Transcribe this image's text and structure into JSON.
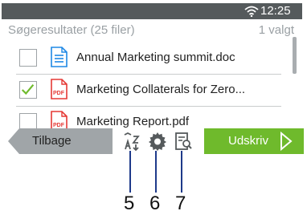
{
  "status": {
    "time": "12:25 PM"
  },
  "header": {
    "title": "Søgeresultater (25 filer)",
    "selected": "1 valgt"
  },
  "files": [
    {
      "name": "Annual Marketing summit.doc",
      "type": "doc",
      "checked": false
    },
    {
      "name": "Marketing Collaterals for Zero...",
      "type": "pdf",
      "checked": true
    },
    {
      "name": "Marketing Report.pdf",
      "type": "pdf",
      "checked": false
    }
  ],
  "file_icons": {
    "doc": "PDF",
    "pdf": "PDF"
  },
  "toolbar": {
    "back_label": "Tilbage",
    "print_label": "Udskriv",
    "icons": [
      "sort-icon",
      "settings-gear-icon",
      "preview-icon"
    ]
  },
  "callouts": [
    "5",
    "6",
    "7"
  ],
  "colors": {
    "statusbar": "#555a5c",
    "back": "#a0a5a8",
    "print": "#6fba2c",
    "check": "#6fba2c",
    "pdf": "#e53935",
    "doc": "#1e88e5"
  }
}
